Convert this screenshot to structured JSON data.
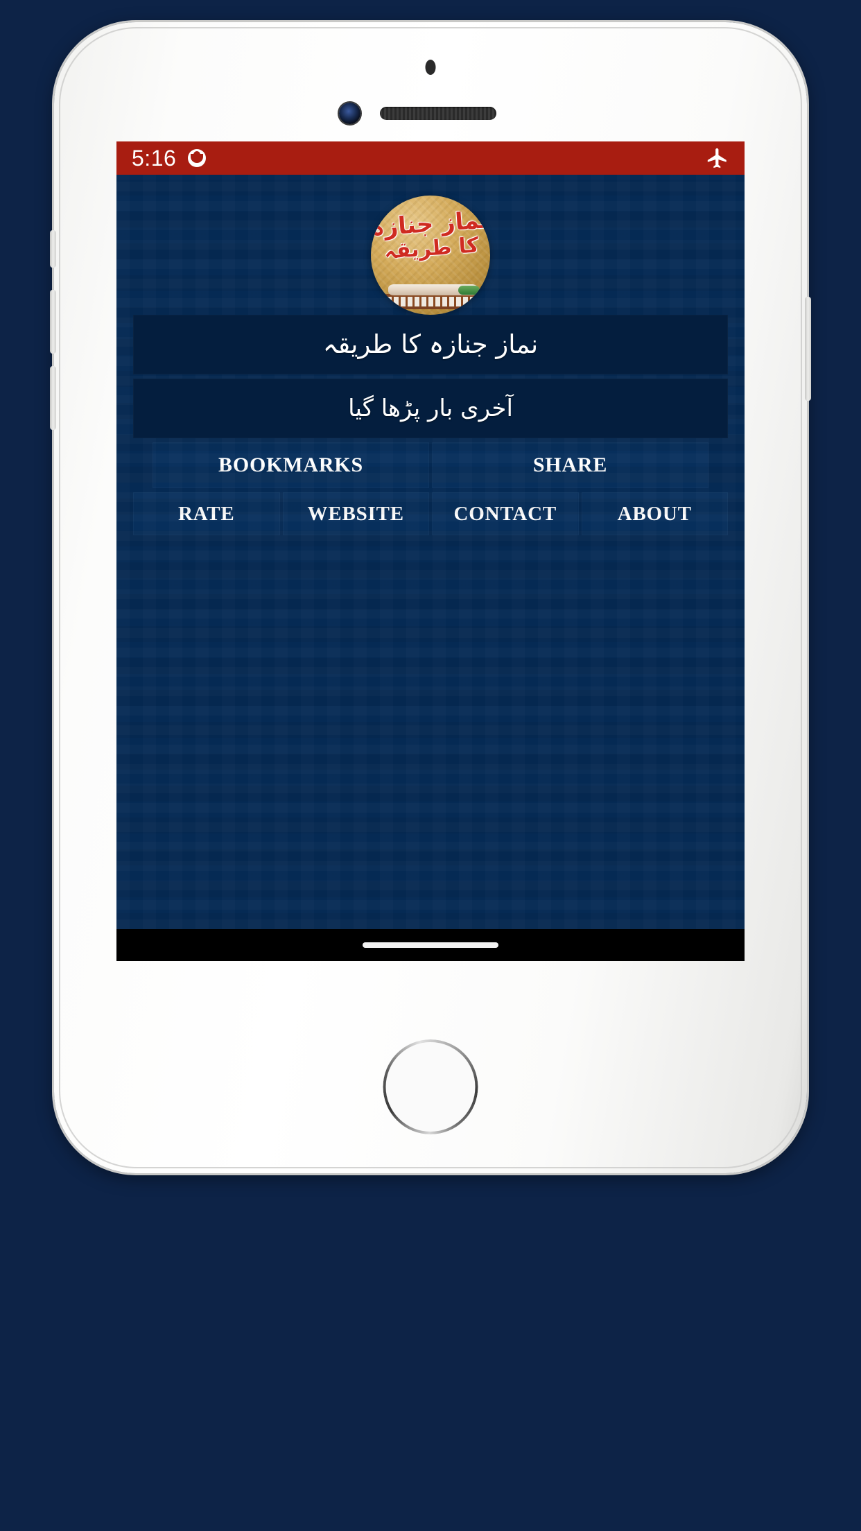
{
  "status_bar": {
    "time": "5:16",
    "notification_icon": "notification-bubble-icon",
    "airplane_icon": "airplane-mode-icon",
    "background_color": "#a81d11"
  },
  "app": {
    "logo": {
      "icon_name": "app-logo-janaza",
      "calligraphy_line1": "نماز جنازہ",
      "calligraphy_line2": "کا طریقہ",
      "background_color": "#c9a053",
      "text_color": "#cf2b21"
    },
    "title_card": {
      "text": "نماز جنازہ کا طریقہ"
    },
    "last_read_card": {
      "text": "آخری بار پڑھا گیا"
    },
    "primary_buttons": [
      {
        "label": "BOOKMARKS",
        "name": "bookmarks-button"
      },
      {
        "label": "SHARE",
        "name": "share-button"
      }
    ],
    "secondary_buttons": [
      {
        "label": "RATE",
        "name": "rate-button"
      },
      {
        "label": "WEBSITE",
        "name": "website-button"
      },
      {
        "label": "CONTACT",
        "name": "contact-button"
      },
      {
        "label": "ABOUT",
        "name": "about-button"
      }
    ],
    "background_color": "#052a54",
    "card_color": "#041e3e",
    "button_color": "#072f5c"
  },
  "nav_bar": {
    "home_indicator": "home-indicator-pill"
  },
  "device": {
    "frame_color": "#ffffff",
    "home_button": "home-button"
  }
}
